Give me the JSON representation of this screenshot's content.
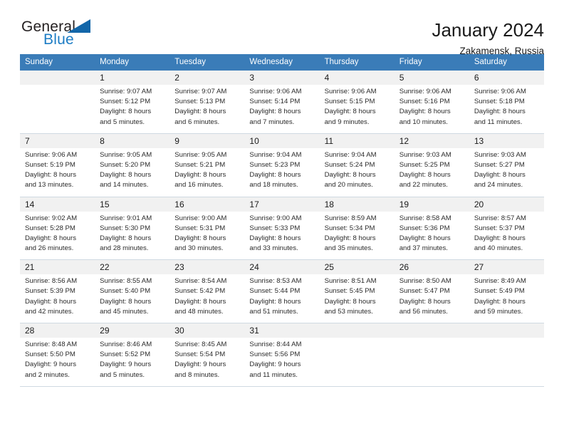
{
  "brand": {
    "name_part1": "General",
    "name_part2": "Blue",
    "triangle_color": "#1266a9",
    "blue_color": "#1c7cc4"
  },
  "header": {
    "title": "January 2024",
    "location": "Zakamensk, Russia",
    "header_bg_color": "#3a7cb8",
    "number_row_bg_color": "#f1f1f1"
  },
  "weekdays": [
    "Sunday",
    "Monday",
    "Tuesday",
    "Wednesday",
    "Thursday",
    "Friday",
    "Saturday"
  ],
  "labels": {
    "sunrise_prefix": "Sunrise:",
    "sunset_prefix": "Sunset:",
    "daylight_prefix": "Daylight:"
  },
  "weeks": [
    {
      "days": [
        {
          "num": "",
          "line1": "",
          "line2": "",
          "line3": "",
          "line4": ""
        },
        {
          "num": "1",
          "line1": "Sunrise: 9:07 AM",
          "line2": "Sunset: 5:12 PM",
          "line3": "Daylight: 8 hours",
          "line4": "and 5 minutes."
        },
        {
          "num": "2",
          "line1": "Sunrise: 9:07 AM",
          "line2": "Sunset: 5:13 PM",
          "line3": "Daylight: 8 hours",
          "line4": "and 6 minutes."
        },
        {
          "num": "3",
          "line1": "Sunrise: 9:06 AM",
          "line2": "Sunset: 5:14 PM",
          "line3": "Daylight: 8 hours",
          "line4": "and 7 minutes."
        },
        {
          "num": "4",
          "line1": "Sunrise: 9:06 AM",
          "line2": "Sunset: 5:15 PM",
          "line3": "Daylight: 8 hours",
          "line4": "and 9 minutes."
        },
        {
          "num": "5",
          "line1": "Sunrise: 9:06 AM",
          "line2": "Sunset: 5:16 PM",
          "line3": "Daylight: 8 hours",
          "line4": "and 10 minutes."
        },
        {
          "num": "6",
          "line1": "Sunrise: 9:06 AM",
          "line2": "Sunset: 5:18 PM",
          "line3": "Daylight: 8 hours",
          "line4": "and 11 minutes."
        }
      ]
    },
    {
      "days": [
        {
          "num": "7",
          "line1": "Sunrise: 9:06 AM",
          "line2": "Sunset: 5:19 PM",
          "line3": "Daylight: 8 hours",
          "line4": "and 13 minutes."
        },
        {
          "num": "8",
          "line1": "Sunrise: 9:05 AM",
          "line2": "Sunset: 5:20 PM",
          "line3": "Daylight: 8 hours",
          "line4": "and 14 minutes."
        },
        {
          "num": "9",
          "line1": "Sunrise: 9:05 AM",
          "line2": "Sunset: 5:21 PM",
          "line3": "Daylight: 8 hours",
          "line4": "and 16 minutes."
        },
        {
          "num": "10",
          "line1": "Sunrise: 9:04 AM",
          "line2": "Sunset: 5:23 PM",
          "line3": "Daylight: 8 hours",
          "line4": "and 18 minutes."
        },
        {
          "num": "11",
          "line1": "Sunrise: 9:04 AM",
          "line2": "Sunset: 5:24 PM",
          "line3": "Daylight: 8 hours",
          "line4": "and 20 minutes."
        },
        {
          "num": "12",
          "line1": "Sunrise: 9:03 AM",
          "line2": "Sunset: 5:25 PM",
          "line3": "Daylight: 8 hours",
          "line4": "and 22 minutes."
        },
        {
          "num": "13",
          "line1": "Sunrise: 9:03 AM",
          "line2": "Sunset: 5:27 PM",
          "line3": "Daylight: 8 hours",
          "line4": "and 24 minutes."
        }
      ]
    },
    {
      "days": [
        {
          "num": "14",
          "line1": "Sunrise: 9:02 AM",
          "line2": "Sunset: 5:28 PM",
          "line3": "Daylight: 8 hours",
          "line4": "and 26 minutes."
        },
        {
          "num": "15",
          "line1": "Sunrise: 9:01 AM",
          "line2": "Sunset: 5:30 PM",
          "line3": "Daylight: 8 hours",
          "line4": "and 28 minutes."
        },
        {
          "num": "16",
          "line1": "Sunrise: 9:00 AM",
          "line2": "Sunset: 5:31 PM",
          "line3": "Daylight: 8 hours",
          "line4": "and 30 minutes."
        },
        {
          "num": "17",
          "line1": "Sunrise: 9:00 AM",
          "line2": "Sunset: 5:33 PM",
          "line3": "Daylight: 8 hours",
          "line4": "and 33 minutes."
        },
        {
          "num": "18",
          "line1": "Sunrise: 8:59 AM",
          "line2": "Sunset: 5:34 PM",
          "line3": "Daylight: 8 hours",
          "line4": "and 35 minutes."
        },
        {
          "num": "19",
          "line1": "Sunrise: 8:58 AM",
          "line2": "Sunset: 5:36 PM",
          "line3": "Daylight: 8 hours",
          "line4": "and 37 minutes."
        },
        {
          "num": "20",
          "line1": "Sunrise: 8:57 AM",
          "line2": "Sunset: 5:37 PM",
          "line3": "Daylight: 8 hours",
          "line4": "and 40 minutes."
        }
      ]
    },
    {
      "days": [
        {
          "num": "21",
          "line1": "Sunrise: 8:56 AM",
          "line2": "Sunset: 5:39 PM",
          "line3": "Daylight: 8 hours",
          "line4": "and 42 minutes."
        },
        {
          "num": "22",
          "line1": "Sunrise: 8:55 AM",
          "line2": "Sunset: 5:40 PM",
          "line3": "Daylight: 8 hours",
          "line4": "and 45 minutes."
        },
        {
          "num": "23",
          "line1": "Sunrise: 8:54 AM",
          "line2": "Sunset: 5:42 PM",
          "line3": "Daylight: 8 hours",
          "line4": "and 48 minutes."
        },
        {
          "num": "24",
          "line1": "Sunrise: 8:53 AM",
          "line2": "Sunset: 5:44 PM",
          "line3": "Daylight: 8 hours",
          "line4": "and 51 minutes."
        },
        {
          "num": "25",
          "line1": "Sunrise: 8:51 AM",
          "line2": "Sunset: 5:45 PM",
          "line3": "Daylight: 8 hours",
          "line4": "and 53 minutes."
        },
        {
          "num": "26",
          "line1": "Sunrise: 8:50 AM",
          "line2": "Sunset: 5:47 PM",
          "line3": "Daylight: 8 hours",
          "line4": "and 56 minutes."
        },
        {
          "num": "27",
          "line1": "Sunrise: 8:49 AM",
          "line2": "Sunset: 5:49 PM",
          "line3": "Daylight: 8 hours",
          "line4": "and 59 minutes."
        }
      ]
    },
    {
      "days": [
        {
          "num": "28",
          "line1": "Sunrise: 8:48 AM",
          "line2": "Sunset: 5:50 PM",
          "line3": "Daylight: 9 hours",
          "line4": "and 2 minutes."
        },
        {
          "num": "29",
          "line1": "Sunrise: 8:46 AM",
          "line2": "Sunset: 5:52 PM",
          "line3": "Daylight: 9 hours",
          "line4": "and 5 minutes."
        },
        {
          "num": "30",
          "line1": "Sunrise: 8:45 AM",
          "line2": "Sunset: 5:54 PM",
          "line3": "Daylight: 9 hours",
          "line4": "and 8 minutes."
        },
        {
          "num": "31",
          "line1": "Sunrise: 8:44 AM",
          "line2": "Sunset: 5:56 PM",
          "line3": "Daylight: 9 hours",
          "line4": "and 11 minutes."
        },
        {
          "num": "",
          "line1": "",
          "line2": "",
          "line3": "",
          "line4": ""
        },
        {
          "num": "",
          "line1": "",
          "line2": "",
          "line3": "",
          "line4": ""
        },
        {
          "num": "",
          "line1": "",
          "line2": "",
          "line3": "",
          "line4": ""
        }
      ]
    }
  ]
}
